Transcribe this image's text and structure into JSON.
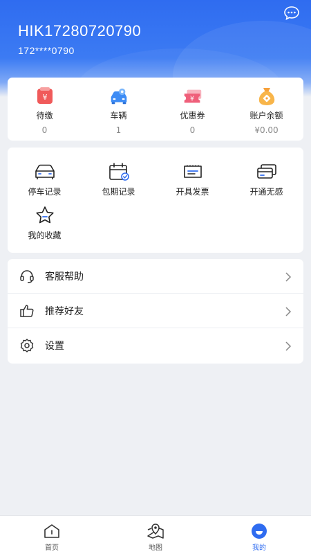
{
  "header": {
    "username": "HIK17280720790",
    "phone": "172****0790",
    "message_icon": "chat-bubble-icon"
  },
  "stats": [
    {
      "label": "待缴",
      "value": "0",
      "icon": "pending-payment-icon"
    },
    {
      "label": "车辆",
      "value": "1",
      "icon": "car-icon"
    },
    {
      "label": "优惠券",
      "value": "0",
      "icon": "coupon-icon"
    },
    {
      "label": "账户余额",
      "value": "¥0.00",
      "icon": "money-bag-icon"
    }
  ],
  "services": [
    {
      "label": "停车记录",
      "icon": "parking-car-icon"
    },
    {
      "label": "包期记录",
      "icon": "calendar-check-icon"
    },
    {
      "label": "开具发票",
      "icon": "invoice-icon"
    },
    {
      "label": "开通无感",
      "icon": "card-icon"
    },
    {
      "label": "我的收藏",
      "icon": "star-icon"
    }
  ],
  "menu": [
    {
      "label": "客服帮助",
      "icon": "headset-icon"
    },
    {
      "label": "推荐好友",
      "icon": "thumbs-up-icon"
    },
    {
      "label": "设置",
      "icon": "gear-icon"
    }
  ],
  "tabs": [
    {
      "label": "首页",
      "icon": "home-icon"
    },
    {
      "label": "地图",
      "icon": "map-pin-icon"
    },
    {
      "label": "我的",
      "icon": "profile-icon",
      "active": true
    }
  ],
  "colors": {
    "accent": "#2f6cf0",
    "background": "#eef0f4"
  }
}
